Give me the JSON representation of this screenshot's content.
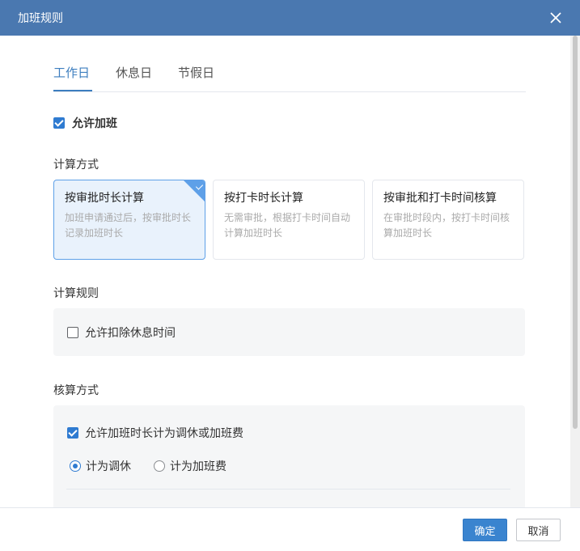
{
  "dialog": {
    "title": "加班规则"
  },
  "tabs": [
    {
      "label": "工作日"
    },
    {
      "label": "休息日"
    },
    {
      "label": "节假日"
    }
  ],
  "allow_overtime": {
    "label": "允许加班",
    "checked": true
  },
  "calc_method": {
    "label": "计算方式",
    "cards": [
      {
        "title": "按审批时长计算",
        "desc": "加班申请通过后，按审批时长记录加班时长",
        "selected": true
      },
      {
        "title": "按打卡时长计算",
        "desc": "无需审批，根据打卡时间自动计算加班时长",
        "selected": false
      },
      {
        "title": "按审批和打卡时间核算",
        "desc": "在审批时段内，按打卡时间核算加班时长",
        "selected": false
      }
    ]
  },
  "calc_rules": {
    "label": "计算规则",
    "deduct_rest": {
      "label": "允许扣除休息时间",
      "checked": false
    }
  },
  "accounting": {
    "label": "核算方式",
    "allow_count": {
      "label": "允许加班时长计为调休或加班费",
      "checked": true
    },
    "options": [
      {
        "label": "计为调休",
        "selected": true
      },
      {
        "label": "计为加班费",
        "selected": false
      }
    ]
  },
  "footer": {
    "confirm": "确定",
    "cancel": "取消"
  },
  "colors": {
    "accent": "#3d7ebf",
    "titlebar": "#4a78b0",
    "primary_button": "#3a84cf"
  }
}
